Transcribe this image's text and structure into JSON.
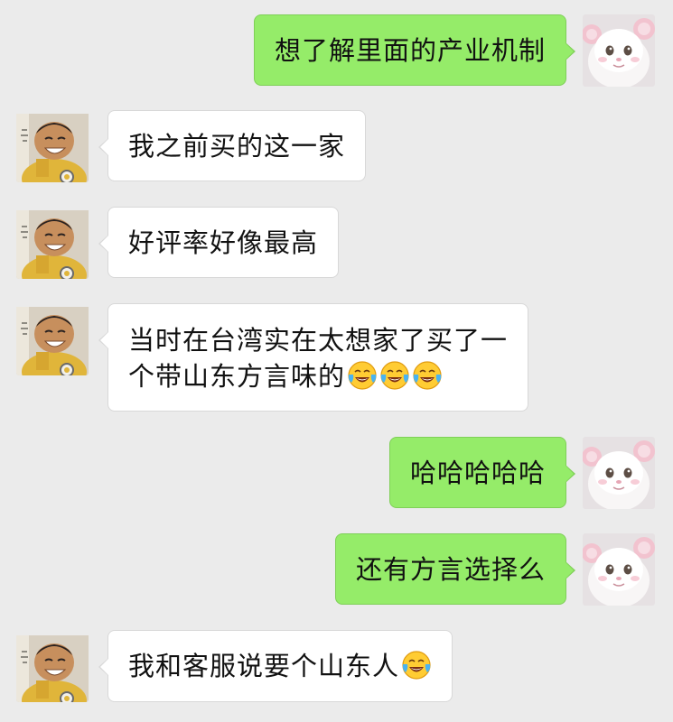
{
  "messages": [
    {
      "side": "me",
      "text": "想了解里面的产业机制"
    },
    {
      "side": "them",
      "text": "我之前买的这一家"
    },
    {
      "side": "them",
      "text": "好评率好像最高"
    },
    {
      "side": "them",
      "line1": "当时在台湾实在太想家了买了一",
      "line2": "个带山东方言味的",
      "emoji": [
        "laughing-crying-emoji",
        "laughing-crying-emoji",
        "laughing-crying-emoji"
      ]
    },
    {
      "side": "me",
      "text": "哈哈哈哈哈"
    },
    {
      "side": "me",
      "text": "还有方言选择么"
    },
    {
      "side": "them",
      "text": "我和客服说要个山东人",
      "emoji": [
        "laughing-crying-emoji"
      ]
    }
  ],
  "colors": {
    "background": "#ebebeb",
    "my_bubble": "#95ec69",
    "their_bubble": "#ffffff"
  },
  "avatars": {
    "me": "white-cat-in-pink-ear-hat",
    "them": "smiling-child-in-yellow-jacket"
  }
}
